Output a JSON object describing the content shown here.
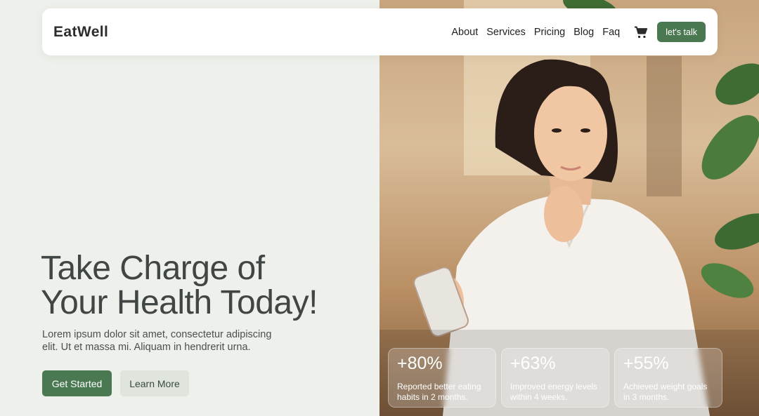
{
  "header": {
    "logo": "EatWell",
    "nav": [
      "About",
      "Services",
      "Pricing",
      "Blog",
      "Faq"
    ],
    "cta_label": "let's talk"
  },
  "hero": {
    "title_line1": "Take Charge of",
    "title_line2": "Your Health Today!",
    "description": "Lorem ipsum dolor sit amet, consectetur adipiscing elit. Ut et massa mi. Aliquam in hendrerit urna.",
    "primary_button": "Get Started",
    "secondary_button": "Learn More"
  },
  "stats": [
    {
      "value": "+80%",
      "text": "Reported better eating habits in 2 months."
    },
    {
      "value": "+63%",
      "text": "Improved energy levels within 4 weeks."
    },
    {
      "value": "+55%",
      "text": "Achieved weight goals in 3 months."
    }
  ],
  "colors": {
    "accent": "#4a7850",
    "background": "#eef0eb",
    "secondary_button_bg": "#dfe4dd",
    "title_text": "#3f4644"
  },
  "icons": {
    "cart": "shopping-cart-icon"
  }
}
